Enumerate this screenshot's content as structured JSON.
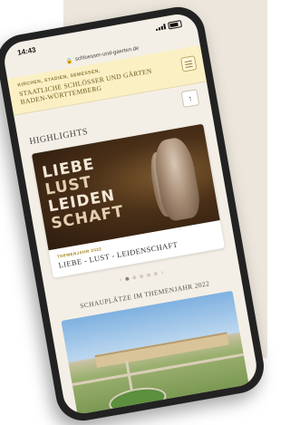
{
  "status": {
    "time": "14:43"
  },
  "browser": {
    "url": "schloesser-und-gaerten.de"
  },
  "header": {
    "eyebrow": "KIRCHEN, STADIEN, SEMESSEN,",
    "brand_line1": "STAATLICHE SCHLÖSSER UND GÄRTEN",
    "brand_line2": "BADEN-WÜRTTEMBERG"
  },
  "highlights": {
    "title": "HIGHLIGHTS",
    "card": {
      "image_words": [
        "LIEBE",
        "LUST",
        "LEIDEN",
        "SCHAFT"
      ],
      "kicker": "THEMENJAHR 2022",
      "title": "LIEBE - LUST - LEIDENSCHAFT"
    },
    "pager": {
      "pages": 5,
      "active": 1
    }
  },
  "schauplaetze": {
    "title": "SCHAUPLÄTZE IM THEMENJAHR 2022"
  },
  "colors": {
    "header_bg": "#fbf0c4",
    "screen_bg": "#f4efe6",
    "gold": "#a28318"
  },
  "icons": [
    "lock-icon",
    "menu-icon",
    "arrow-up-icon",
    "chevron-left-icon",
    "chevron-right-icon"
  ]
}
